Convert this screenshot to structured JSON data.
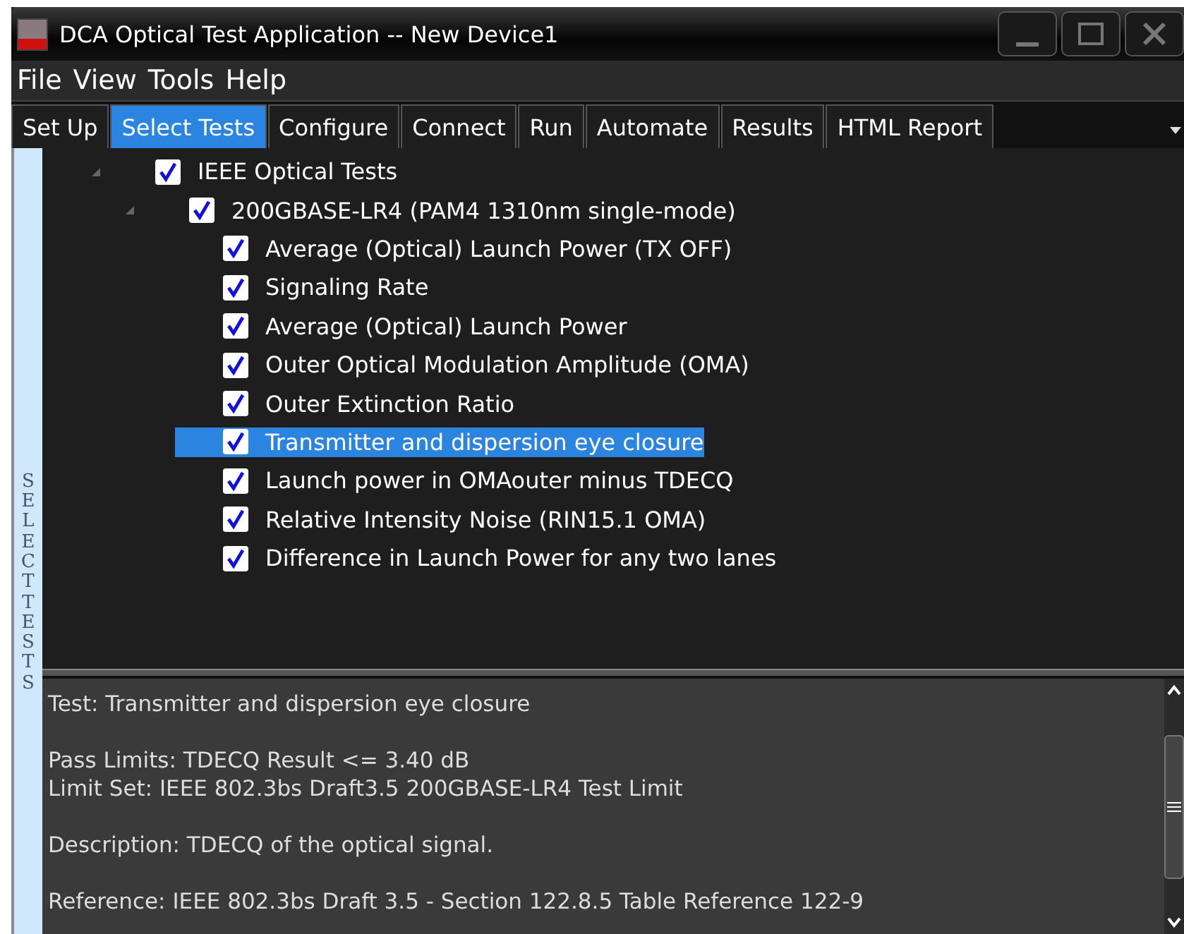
{
  "window": {
    "title": "DCA Optical Test Application -- New Device1"
  },
  "menu": [
    "File",
    "View",
    "Tools",
    "Help"
  ],
  "tabs": [
    {
      "label": "Set Up",
      "selected": false
    },
    {
      "label": "Select Tests",
      "selected": true
    },
    {
      "label": "Configure",
      "selected": false
    },
    {
      "label": "Connect",
      "selected": false
    },
    {
      "label": "Run",
      "selected": false
    },
    {
      "label": "Automate",
      "selected": false
    },
    {
      "label": "Results",
      "selected": false
    },
    {
      "label": "HTML Report",
      "selected": false
    }
  ],
  "side_label": "SELECT TESTS",
  "tree": [
    {
      "label": "IEEE Optical Tests",
      "checked": true,
      "selected": false,
      "expanded": true,
      "children": [
        {
          "label": "200GBASE-LR4 (PAM4 1310nm single-mode)",
          "checked": true,
          "selected": false,
          "expanded": true,
          "children": [
            {
              "label": "Average (Optical) Launch Power (TX OFF)",
              "checked": true,
              "selected": false
            },
            {
              "label": "Signaling Rate",
              "checked": true,
              "selected": false
            },
            {
              "label": "Average (Optical) Launch Power",
              "checked": true,
              "selected": false
            },
            {
              "label": "Outer Optical Modulation Amplitude (OMA)",
              "checked": true,
              "selected": false
            },
            {
              "label": "Outer Extinction Ratio",
              "checked": true,
              "selected": false
            },
            {
              "label": "Transmitter and dispersion eye closure",
              "checked": true,
              "selected": true
            },
            {
              "label": "Launch power in OMAouter minus TDECQ",
              "checked": true,
              "selected": false
            },
            {
              "label": "Relative Intensity Noise (RIN15.1 OMA)",
              "checked": true,
              "selected": false
            },
            {
              "label": "Difference in Launch Power for any two lanes",
              "checked": true,
              "selected": false
            }
          ]
        }
      ]
    }
  ],
  "details": [
    [
      "Test: Transmitter and dispersion eye closure"
    ],
    [
      "Pass Limits: TDECQ Result <= 3.40 dB",
      "Limit Set: IEEE 802.3bs Draft3.5 200GBASE-LR4 Test Limit"
    ],
    [
      "Description: TDECQ of the optical signal."
    ],
    [
      "Reference: IEEE 802.3bs Draft 3.5 - Section 122.8.5 Table Reference 122-9"
    ]
  ]
}
